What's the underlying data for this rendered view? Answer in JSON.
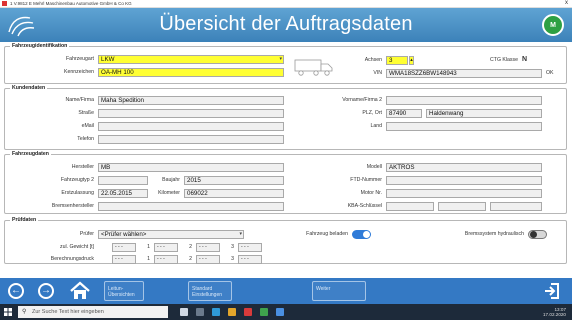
{
  "window": {
    "title": "1 V.9812 E Mehrl Maschinenbau Automotive GmbH & Co KG",
    "close_glyph": "x"
  },
  "header": {
    "title": "Übersicht der Auftragsdaten"
  },
  "vehicle_id": {
    "legend": "Fahrzeugidentifikation",
    "fahrzeugart_label": "Fahrzeugart",
    "fahrzeugart_value": "LKW",
    "kennzeichen_label": "Kennzeichen",
    "kennzeichen_value": "OA-MH 100",
    "achsen_label": "Achsen",
    "achsen_value": "3",
    "ctg_label": "CTG Klasse",
    "ctg_value": "N",
    "vin_label": "VIN",
    "vin_value": "WMA18SZZ6BW148943",
    "ok_label": "OK"
  },
  "customer": {
    "legend": "Kundendaten",
    "name_label": "Name/Firma",
    "name_value": "Maha Spedition",
    "vorname_label": "Vorname/Firma 2",
    "vorname_value": "",
    "strasse_label": "Straße",
    "strasse_value": "",
    "plz_label": "PLZ, Ort",
    "plz_value": "87490",
    "ort_value": "Haldenwang",
    "email_label": "eMail",
    "email_value": "",
    "land_label": "Land",
    "land_value": "",
    "telefon_label": "Telefon",
    "telefon_value": ""
  },
  "vehicle_data": {
    "legend": "Fahrzeugdaten",
    "hersteller_label": "Hersteller",
    "hersteller_value": "MB",
    "modell_label": "Modell",
    "modell_value": "AKTROS",
    "fahrzeugtyp_label": "Fahrzeugtyp 2",
    "fahrzeugtyp_value": "",
    "baujahr_label": "Baujahr",
    "baujahr_value": "2015",
    "ftd_label": "FTD-Nummer",
    "ftd_value": "",
    "erstzulassung_label": "Erstzulassung",
    "erstzulassung_value": "22.05.2015",
    "km_label": "Kilometer",
    "km_value": "069022",
    "motor_label": "Motor Nr.",
    "motor_value": "",
    "brems_label": "Bremsenhersteller",
    "brems_value": "",
    "kba_label": "KBA-Schlüssel",
    "kba_value": ""
  },
  "tests": {
    "legend": "Prüfdaten",
    "pruefer_label": "Prüfer",
    "pruefer_value": "<Prüfer wählen>",
    "beladen_label": "Fahrzeug beladen",
    "bremssystem_label": "Bremssystem hydraulisch",
    "zul_label": "zul. Gewicht [t]",
    "druck_label": "Berechnungsdruck",
    "axle_1": "1",
    "axle_2": "2",
    "axle_3": "3",
    "dash": "- - -"
  },
  "nav": {
    "btn1": "Leitun-\nÜbersichten",
    "btn2": "Standard\nEinstellungen",
    "btn3": "Weiter",
    "back_glyph": "←",
    "forward_glyph": "→"
  },
  "taskbar": {
    "search_placeholder": "Zur Suche Text hier eingeben",
    "time": "13:07",
    "date": "17.02.2020"
  },
  "colors": {
    "header": "#3c82b9",
    "toggle_on": "#2f7bd8",
    "highlight": "#ffff33",
    "navbar": "#3479c4"
  },
  "icons": [
    "app-logo-icon",
    "green-badge-icon",
    "truck-icon",
    "back-arrow-icon",
    "forward-arrow-icon",
    "home-icon",
    "exit-icon",
    "windows-icon",
    "search-icon"
  ]
}
